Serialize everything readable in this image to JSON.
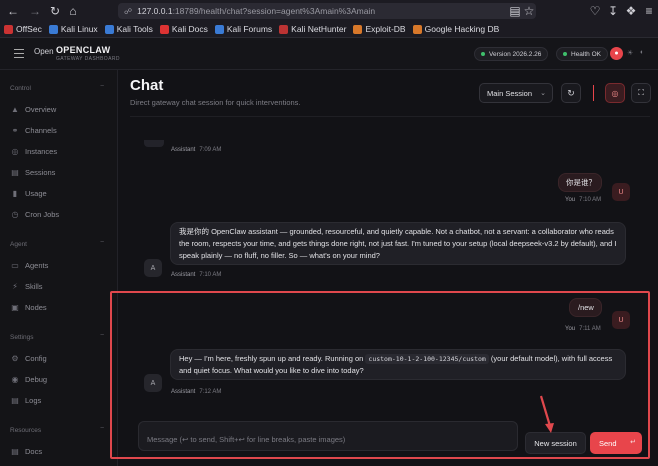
{
  "browser": {
    "url_host": "127.0.0.1",
    "url_rest": ":18789/health/chat?session=agent%3Amain%3Amain",
    "bookmarks": [
      "OffSec",
      "Kali Linux",
      "Kali Tools",
      "Kali Docs",
      "Kali Forums",
      "Kali NetHunter",
      "Exploit-DB",
      "Google Hacking DB"
    ]
  },
  "header": {
    "brand_prefix": "Open",
    "brand_name": "OPENCLAW",
    "brand_sub": "GATEWAY DASHBOARD",
    "version_pill": "Version 2026.2.26",
    "health_pill": "Health OK"
  },
  "sidebar": {
    "sections": [
      {
        "label": "Control",
        "items": [
          "Overview",
          "Channels",
          "Instances",
          "Sessions",
          "Usage",
          "Cron Jobs"
        ]
      },
      {
        "label": "Agent",
        "items": [
          "Agents",
          "Skills",
          "Nodes"
        ]
      },
      {
        "label": "Settings",
        "items": [
          "Config",
          "Debug",
          "Logs"
        ]
      },
      {
        "label": "Resources",
        "items": [
          "Docs"
        ]
      }
    ]
  },
  "page": {
    "title": "Chat",
    "subtitle": "Direct gateway chat session for quick interventions.",
    "session_select": "Main Session"
  },
  "messages": [
    {
      "role": "assistant",
      "author": "Assistant",
      "time": "7:09 AM"
    },
    {
      "role": "user",
      "author": "You",
      "time": "7:10 AM",
      "text": "你是谁？",
      "avatar": "U"
    },
    {
      "role": "assistant",
      "author": "Assistant",
      "time": "7:10 AM",
      "avatar": "A",
      "text": "我是你的 OpenClaw assistant — grounded, resourceful, and quietly capable. Not a chatbot, not a servant: a collaborator who reads the room, respects your time, and gets things done right, not just fast. I'm tuned to your setup (local deepseek-v3.2 by default), and I speak plainly — no fluff, no filler. So — what's on your mind?"
    },
    {
      "role": "user",
      "author": "You",
      "time": "7:11 AM",
      "text": "/new",
      "avatar": "U"
    },
    {
      "role": "assistant",
      "author": "Assistant",
      "time": "7:12 AM",
      "avatar": "A",
      "text_before": "Hey — I'm here, freshly spun up and ready. Running on",
      "code": "custom-10-1-2-100-12345/custom",
      "text_after": "(your default model), with full access and quiet focus. What would you like to dive into today?"
    }
  ],
  "composer": {
    "placeholder": "Message (↩ to send, Shift+↩ for line breaks, paste images)",
    "new_session_label": "New session",
    "send_label": "Send"
  },
  "colors": {
    "accent": "#e8454b",
    "highlight_border": "#e0484d",
    "status_ok": "#3fbf6b"
  }
}
